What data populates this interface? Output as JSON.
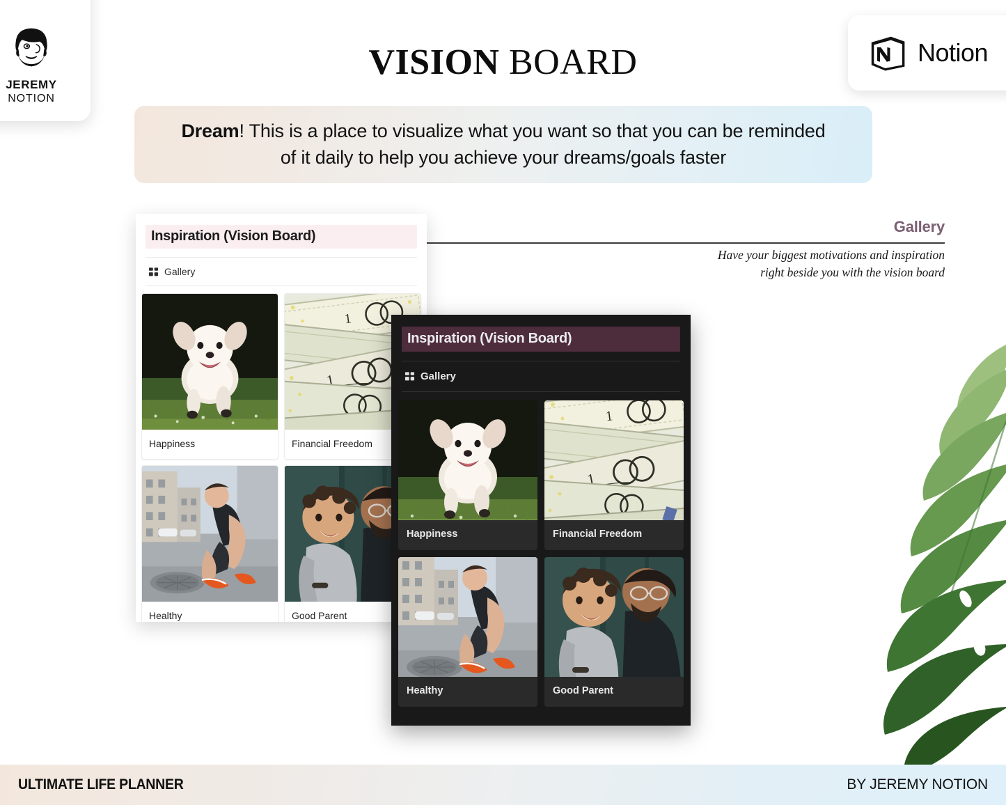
{
  "brand": {
    "logo_icon": "bearded-man-face-icon",
    "name_line1": "JEREMY",
    "name_line2": "NOTION"
  },
  "header": {
    "title_bold": "VISION",
    "title_regular": "BOARD",
    "notion_badge": {
      "icon": "notion-cube-icon",
      "label": "Notion"
    }
  },
  "banner": {
    "lead": "Dream",
    "text": "! This is a place to visualize what you want so that you can be reminded of it daily to help you achieve your dreams/goals faster",
    "gradient_start": "#f3e7dd",
    "gradient_end": "#d9eef8"
  },
  "annotation": {
    "title": "Gallery",
    "title_color": "#7c5f73",
    "description": "Have your biggest motivations and inspiration right beside you with the vision board"
  },
  "light_window": {
    "title": "Inspiration (Vision Board)",
    "title_highlight_color": "#fbeef1",
    "view": {
      "icon": "gallery-grid-icon",
      "label": "Gallery"
    },
    "cards": [
      {
        "label": "Happiness",
        "image": "white-dog-running-on-grass-photo"
      },
      {
        "label": "Financial Freedom",
        "image": "stack-of-hundred-dollar-bills-photo"
      },
      {
        "label": "Healthy",
        "image": "runner-tying-shoe-on-street-photo"
      },
      {
        "label": "Good Parent",
        "image": "father-kissing-toddler-photo"
      }
    ]
  },
  "dark_window": {
    "title": "Inspiration (Vision Board)",
    "title_highlight_color": "#4d2c3c",
    "background_color": "#191919",
    "view": {
      "icon": "gallery-grid-icon",
      "label": "Gallery"
    },
    "cards": [
      {
        "label": "Happiness",
        "image": "white-dog-running-on-grass-photo"
      },
      {
        "label": "Financial Freedom",
        "image": "stack-of-hundred-dollar-bills-photo"
      },
      {
        "label": "Healthy",
        "image": "runner-tying-shoe-on-street-photo"
      },
      {
        "label": "Good Parent",
        "image": "father-kissing-toddler-photo"
      }
    ]
  },
  "decoration": {
    "leaf_icon": "monstera-leaf-icon"
  },
  "footer": {
    "left": "ULTIMATE LIFE PLANNER",
    "right": "BY JEREMY NOTION"
  }
}
